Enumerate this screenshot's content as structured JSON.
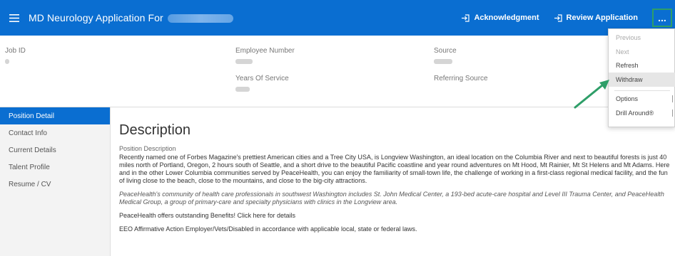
{
  "header": {
    "title": "MD Neurology Application For",
    "acknowledgment_label": "Acknowledgment",
    "review_application_label": "Review Application",
    "more_label": "..."
  },
  "info": {
    "job_id_label": "Job ID",
    "employee_number_label": "Employee Number",
    "years_of_service_label": "Years Of Service",
    "source_label": "Source",
    "referring_source_label": "Referring Source"
  },
  "sidebar": {
    "items": [
      {
        "label": "Position Detail",
        "active": true
      },
      {
        "label": "Contact Info",
        "active": false
      },
      {
        "label": "Current Details",
        "active": false
      },
      {
        "label": "Talent Profile",
        "active": false
      },
      {
        "label": "Resume / CV",
        "active": false
      }
    ]
  },
  "content": {
    "heading": "Description",
    "sub_label": "Position Description",
    "paragraph1": "Recently named one of Forbes Magazine's prettiest American cities and a Tree City USA, is Longview Washington, an ideal location on the Columbia River and next to beautiful forests is just 40 miles north of Portland, Oregon, 2 hours south of Seattle, and a short drive to the beautiful Pacific coastline and year round adventures on Mt Hood, Mt Rainier, Mt St Helens and Mt Adams. Here and in the other Lower Columbia communities served by PeaceHealth, you can enjoy the familiarity of small-town life, the challenge of working in a first-class regional medical facility, and the fun of living close to the beach, close to the mountains, and close to the big-city attractions.",
    "paragraph2": "PeaceHealth's community of health care professionals in southwest Washington includes St. John Medical Center, a 193-bed acute-care hospital and Level III Trauma Center, and PeaceHealth Medical Group, a group of primary-care and specialty physicians with clinics in the Longview area.",
    "paragraph3": "PeaceHealth offers outstanding Benefits! Click here for details",
    "paragraph4": "EEO Affirmative Action Employer/Vets/Disabled in accordance with applicable local, state or federal laws."
  },
  "dropdown": {
    "previous": "Previous",
    "next": "Next",
    "refresh": "Refresh",
    "withdraw": "Withdraw",
    "options": "Options",
    "drill_around": "Drill Around®"
  },
  "colors": {
    "brand_blue": "#0a6ed1",
    "annotation_green": "#2e9e68"
  }
}
